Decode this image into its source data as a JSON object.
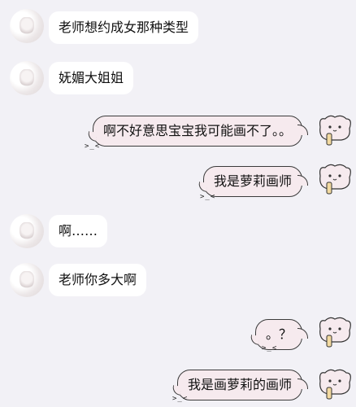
{
  "messages": [
    {
      "side": "left",
      "text": "老师想约成女那种类型"
    },
    {
      "side": "left",
      "text": "妩媚大姐姐"
    },
    {
      "side": "right",
      "text": "啊不好意思宝宝我可能画不了。。",
      "face": ">_<"
    },
    {
      "side": "right",
      "text": "我是萝莉画师",
      "face": ">_<"
    },
    {
      "side": "left",
      "text": "啊……"
    },
    {
      "side": "left",
      "text": "老师你多大啊"
    },
    {
      "side": "right",
      "text": "。？",
      "face": ">_<"
    },
    {
      "side": "right",
      "text": "我是画萝莉的画师",
      "face": ">_<"
    }
  ],
  "icons": {
    "left_avatar": "user-avatar",
    "right_avatar": "cat-avatar"
  }
}
